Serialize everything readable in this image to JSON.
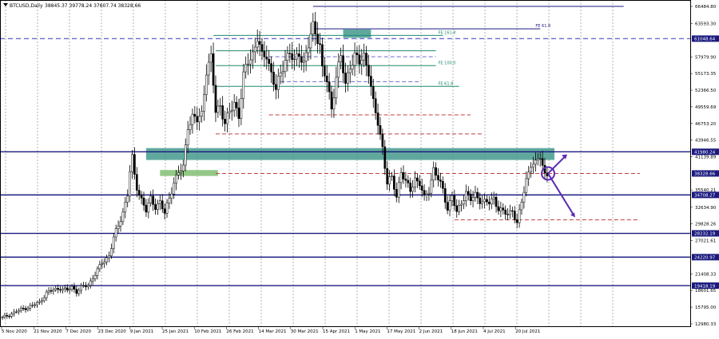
{
  "header": {
    "symbol_text": "BTCUSD,Daily",
    "ohlc_text": "38845.37 39778.24 37607.74 38328.66"
  },
  "colors": {
    "background": "#ffffff",
    "bull_candle": "#000000",
    "bear_candle": "#000000",
    "grid": "#000000",
    "level_line": "#1a1a80",
    "fib_line": "#1f8a6f",
    "zone_fill": "#4f9e93",
    "light_zone_fill": "#88c27a",
    "dashed_red": "#c04040",
    "dashed_blue": "#6a6ad0",
    "arrow": "#5b2ab0",
    "price_tag_bg": "#1a1a80",
    "price_tag_text": "#ffffff"
  },
  "chart_data": {
    "type": "candlestick",
    "title": "BTCUSD,Daily",
    "ylim": [
      12980.33,
      66484.8
    ],
    "y_tick_labels": [
      "66484.80",
      "63593.30",
      "61048.64",
      "57979.90",
      "55173.35",
      "52366.50",
      "49559.69",
      "46753.20",
      "43946.55",
      "41980.24",
      "41139.89",
      "38328.66",
      "35540.21",
      "34708.27",
      "32634.90",
      "29828.26",
      "28232.19",
      "27021.61",
      "24220.97",
      "21408.33",
      "19418.19",
      "18601.65",
      "15795.00",
      "12980.33"
    ],
    "highlighted_prices": [
      {
        "value": 61048.64,
        "label": "61048.64"
      },
      {
        "value": 41980.24,
        "label": "41980.24"
      },
      {
        "value": 38328.66,
        "label": "38328.66"
      },
      {
        "value": 34708.27,
        "label": "34708.27"
      },
      {
        "value": 28232.19,
        "label": "28232.19"
      },
      {
        "value": 24220.97,
        "label": "24220.97"
      },
      {
        "value": 19418.19,
        "label": "19418.19"
      }
    ],
    "x_tick_labels": [
      "5 Nov 2020",
      "21 Nov 2020",
      "7 Dec 2020",
      "23 Dec 2020",
      "9 Jan 2021",
      "25 Jan 2021",
      "10 Feb 2021",
      "26 Feb 2021",
      "14 Mar 2021",
      "30 Mar 2021",
      "15 Apr 2021",
      "1 May 2021",
      "17 May 2021",
      "2 Jun 2021",
      "18 Jun 2021",
      "4 Jul 2021",
      "20 Jul 2021"
    ],
    "close_path": [
      [
        0,
        14000
      ],
      [
        4,
        14700
      ],
      [
        8,
        15400
      ],
      [
        12,
        15900
      ],
      [
        16,
        16600
      ],
      [
        19,
        18200
      ],
      [
        22,
        18700
      ],
      [
        25,
        19000
      ],
      [
        28,
        18600
      ],
      [
        30,
        19200
      ],
      [
        32,
        18400
      ],
      [
        34,
        19100
      ],
      [
        37,
        19500
      ],
      [
        40,
        21400
      ],
      [
        43,
        23200
      ],
      [
        46,
        24500
      ],
      [
        48,
        27500
      ],
      [
        50,
        29400
      ],
      [
        52,
        31900
      ],
      [
        54,
        34800
      ],
      [
        55,
        38700
      ],
      [
        56,
        40800
      ],
      [
        57,
        37800
      ],
      [
        58,
        36000
      ],
      [
        60,
        34000
      ],
      [
        62,
        32000
      ],
      [
        64,
        34000
      ],
      [
        66,
        32800
      ],
      [
        68,
        33500
      ],
      [
        70,
        31500
      ],
      [
        72,
        34200
      ],
      [
        74,
        36900
      ],
      [
        76,
        38400
      ],
      [
        78,
        39300
      ],
      [
        80,
        46500
      ],
      [
        82,
        47800
      ],
      [
        84,
        47200
      ],
      [
        86,
        48400
      ],
      [
        88,
        55900
      ],
      [
        90,
        57600
      ],
      [
        92,
        48800
      ],
      [
        94,
        49900
      ],
      [
        96,
        46800
      ],
      [
        98,
        48500
      ],
      [
        100,
        50300
      ],
      [
        102,
        48200
      ],
      [
        104,
        54600
      ],
      [
        106,
        57200
      ],
      [
        108,
        58600
      ],
      [
        110,
        61300
      ],
      [
        112,
        57800
      ],
      [
        114,
        58400
      ],
      [
        116,
        55300
      ],
      [
        118,
        52400
      ],
      [
        120,
        55000
      ],
      [
        122,
        57800
      ],
      [
        124,
        58700
      ],
      [
        126,
        56800
      ],
      [
        128,
        58800
      ],
      [
        130,
        57000
      ],
      [
        132,
        59800
      ],
      [
        134,
        63000
      ],
      [
        136,
        61400
      ],
      [
        137,
        60100
      ],
      [
        138,
        55800
      ],
      [
        140,
        53800
      ],
      [
        142,
        49100
      ],
      [
        144,
        55000
      ],
      [
        146,
        57800
      ],
      [
        148,
        53200
      ],
      [
        150,
        56700
      ],
      [
        152,
        58100
      ],
      [
        154,
        56900
      ],
      [
        156,
        58200
      ],
      [
        158,
        55700
      ],
      [
        160,
        50000
      ],
      [
        162,
        46800
      ],
      [
        164,
        42800
      ],
      [
        166,
        36700
      ],
      [
        168,
        37500
      ],
      [
        170,
        34500
      ],
      [
        172,
        38800
      ],
      [
        174,
        36700
      ],
      [
        176,
        35500
      ],
      [
        178,
        37500
      ],
      [
        180,
        36600
      ],
      [
        182,
        34000
      ],
      [
        184,
        35600
      ],
      [
        186,
        39100
      ],
      [
        188,
        37300
      ],
      [
        190,
        35500
      ],
      [
        192,
        32500
      ],
      [
        194,
        34500
      ],
      [
        196,
        31600
      ],
      [
        198,
        33500
      ],
      [
        200,
        35200
      ],
      [
        202,
        33800
      ],
      [
        204,
        34700
      ],
      [
        206,
        33900
      ],
      [
        208,
        33500
      ],
      [
        210,
        33300
      ],
      [
        212,
        34200
      ],
      [
        214,
        32400
      ],
      [
        216,
        31800
      ],
      [
        218,
        31400
      ],
      [
        220,
        32300
      ],
      [
        222,
        29800
      ],
      [
        224,
        33500
      ],
      [
        226,
        37300
      ],
      [
        228,
        40000
      ],
      [
        230,
        39800
      ],
      [
        232,
        41300
      ],
      [
        234,
        38300
      ]
    ],
    "horizontal_levels": [
      {
        "value": 61048.64,
        "style": "dashed",
        "color": "#6a6ad0"
      },
      {
        "value": 41980.24,
        "style": "solid",
        "color": "#1a1a80"
      },
      {
        "value": 34708.27,
        "style": "solid",
        "color": "#1a1a80"
      },
      {
        "value": 28232.19,
        "style": "solid",
        "color": "#1a1a80"
      },
      {
        "value": 24220.97,
        "style": "solid",
        "color": "#1a1a80"
      },
      {
        "value": 19418.19,
        "style": "solid",
        "color": "#1a1a80"
      }
    ],
    "fibo_labels": [
      {
        "text": "FE 161.8",
        "value": 61600
      },
      {
        "text": "FE 61.8",
        "value": 62700
      },
      {
        "text": "FE 100.0",
        "value": 56500
      },
      {
        "text": "FE 61.8",
        "value": 53000
      }
    ],
    "grid": true,
    "legend": "none"
  }
}
